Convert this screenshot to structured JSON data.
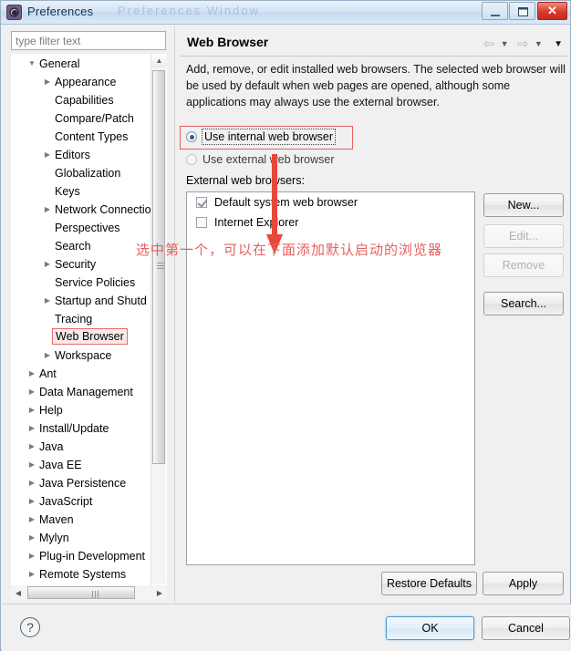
{
  "window": {
    "title": "Preferences",
    "ghost_title": "Preferences    Window",
    "icon": "gear-icon",
    "minimize_label": "",
    "maximize_label": "",
    "close_label": "✕"
  },
  "filter": {
    "placeholder": "type filter text",
    "value": ""
  },
  "tree": {
    "items": [
      {
        "label": "General",
        "level": 0,
        "arrow": "▼",
        "selected": false
      },
      {
        "label": "Appearance",
        "level": 1,
        "arrow": "▶",
        "selected": false
      },
      {
        "label": "Capabilities",
        "level": 1,
        "arrow": "",
        "selected": false
      },
      {
        "label": "Compare/Patch",
        "level": 1,
        "arrow": "",
        "selected": false
      },
      {
        "label": "Content Types",
        "level": 1,
        "arrow": "",
        "selected": false
      },
      {
        "label": "Editors",
        "level": 1,
        "arrow": "▶",
        "selected": false
      },
      {
        "label": "Globalization",
        "level": 1,
        "arrow": "",
        "selected": false
      },
      {
        "label": "Keys",
        "level": 1,
        "arrow": "",
        "selected": false
      },
      {
        "label": "Network Connectio",
        "level": 1,
        "arrow": "▶",
        "selected": false
      },
      {
        "label": "Perspectives",
        "level": 1,
        "arrow": "",
        "selected": false
      },
      {
        "label": "Search",
        "level": 1,
        "arrow": "",
        "selected": false
      },
      {
        "label": "Security",
        "level": 1,
        "arrow": "▶",
        "selected": false
      },
      {
        "label": "Service Policies",
        "level": 1,
        "arrow": "",
        "selected": false
      },
      {
        "label": "Startup and Shutd",
        "level": 1,
        "arrow": "▶",
        "selected": false
      },
      {
        "label": "Tracing",
        "level": 1,
        "arrow": "",
        "selected": false
      },
      {
        "label": "Web Browser",
        "level": 1,
        "arrow": "",
        "selected": true
      },
      {
        "label": "Workspace",
        "level": 1,
        "arrow": "▶",
        "selected": false
      },
      {
        "label": "Ant",
        "level": 0,
        "arrow": "▶",
        "selected": false
      },
      {
        "label": "Data Management",
        "level": 0,
        "arrow": "▶",
        "selected": false
      },
      {
        "label": "Help",
        "level": 0,
        "arrow": "▶",
        "selected": false
      },
      {
        "label": "Install/Update",
        "level": 0,
        "arrow": "▶",
        "selected": false
      },
      {
        "label": "Java",
        "level": 0,
        "arrow": "▶",
        "selected": false
      },
      {
        "label": "Java EE",
        "level": 0,
        "arrow": "▶",
        "selected": false
      },
      {
        "label": "Java Persistence",
        "level": 0,
        "arrow": "▶",
        "selected": false
      },
      {
        "label": "JavaScript",
        "level": 0,
        "arrow": "▶",
        "selected": false
      },
      {
        "label": "Maven",
        "level": 0,
        "arrow": "▶",
        "selected": false
      },
      {
        "label": "Mylyn",
        "level": 0,
        "arrow": "▶",
        "selected": false
      },
      {
        "label": "Plug-in Development",
        "level": 0,
        "arrow": "▶",
        "selected": false
      },
      {
        "label": "Remote Systems",
        "level": 0,
        "arrow": "▶",
        "selected": false
      }
    ]
  },
  "pane": {
    "title": "Web Browser",
    "description": "Add, remove, or edit installed web browsers. The selected web browser will be used by default when web pages are opened, although some applications may always use the external browser.",
    "nav": {
      "back": "⇦",
      "back_caret": "▼",
      "forward": "⇨",
      "forward_caret": "▼",
      "menu_caret": "▼"
    },
    "radios": [
      {
        "label": "Use internal web browser",
        "selected": true,
        "focused": true
      },
      {
        "label": "Use external web browser",
        "selected": false,
        "focused": false
      }
    ],
    "external_label": "External web browsers:",
    "browsers": [
      {
        "label": "Default system web browser",
        "checked": true
      },
      {
        "label": "Internet Explorer",
        "checked": false
      }
    ],
    "side_buttons": [
      {
        "label": "New...",
        "enabled": true
      },
      {
        "label": "Edit...",
        "enabled": false
      },
      {
        "label": "Remove",
        "enabled": false
      },
      {
        "label": "Search...",
        "enabled": true
      }
    ],
    "restore_defaults_label": "Restore Defaults",
    "apply_label": "Apply"
  },
  "footer": {
    "help_icon": "?",
    "ok_label": "OK",
    "cancel_label": "Cancel"
  },
  "annotations": {
    "note_text": "选中第一个，可以在下面添加默认启动的浏览器",
    "color": "#e4605f"
  }
}
